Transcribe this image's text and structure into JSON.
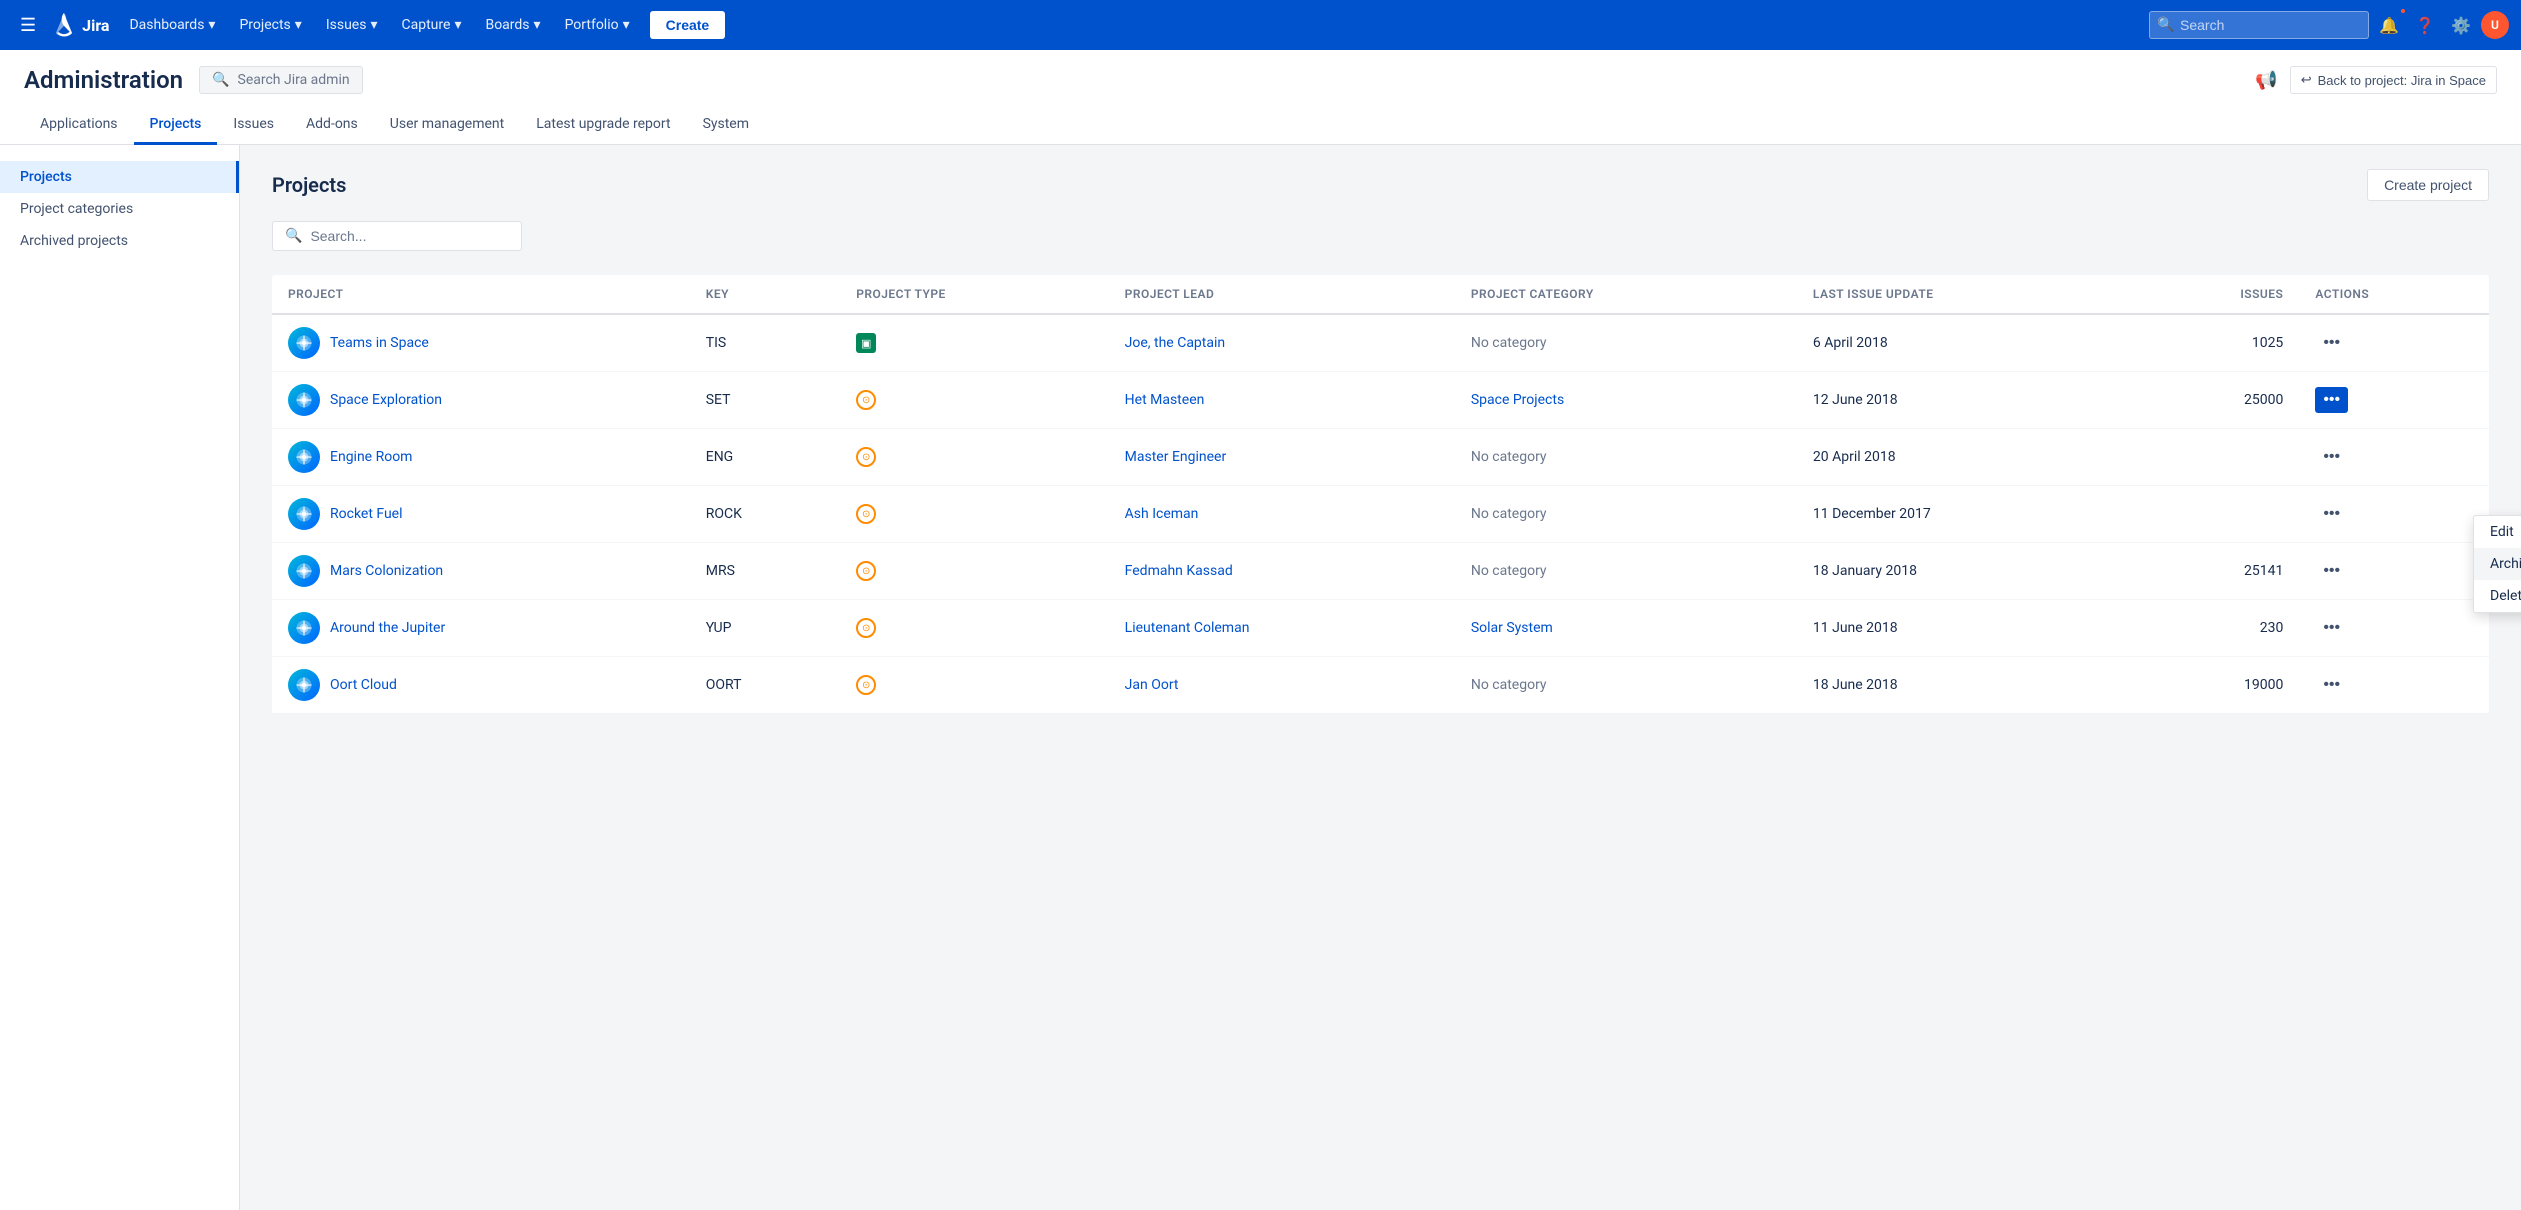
{
  "topnav": {
    "logo_text": "Jira",
    "menu_items": [
      {
        "label": "Dashboards",
        "has_dropdown": true
      },
      {
        "label": "Projects",
        "has_dropdown": true
      },
      {
        "label": "Issues",
        "has_dropdown": true
      },
      {
        "label": "Capture",
        "has_dropdown": true
      },
      {
        "label": "Boards",
        "has_dropdown": true
      },
      {
        "label": "Portfolio",
        "has_dropdown": true
      }
    ],
    "create_label": "Create",
    "search_placeholder": "Search",
    "back_to_project": "Back to project: Jira in Space"
  },
  "admin": {
    "title": "Administration",
    "search_placeholder": "Search Jira admin",
    "tabs": [
      {
        "label": "Applications"
      },
      {
        "label": "Projects",
        "active": true
      },
      {
        "label": "Issues"
      },
      {
        "label": "Add-ons"
      },
      {
        "label": "User management"
      },
      {
        "label": "Latest upgrade report"
      },
      {
        "label": "System"
      }
    ],
    "sidebar": [
      {
        "label": "Projects",
        "active": true
      },
      {
        "label": "Project categories"
      },
      {
        "label": "Archived projects"
      }
    ]
  },
  "projects_page": {
    "title": "Projects",
    "create_project_label": "Create project",
    "search_placeholder": "Search...",
    "columns": [
      {
        "label": "Project"
      },
      {
        "label": "Key"
      },
      {
        "label": "Project type"
      },
      {
        "label": "Project lead"
      },
      {
        "label": "Project category"
      },
      {
        "label": "Last issue update"
      },
      {
        "label": "Issues"
      },
      {
        "label": "Actions"
      }
    ],
    "projects": [
      {
        "name": "Teams in Space",
        "key": "TIS",
        "type": "software",
        "type_style": "green",
        "lead": "Joe, the Captain",
        "category": "No category",
        "category_is_link": false,
        "last_update": "6 April 2018",
        "issues": "1025",
        "icon_color": "teal"
      },
      {
        "name": "Space Exploration",
        "key": "SET",
        "type": "software",
        "type_style": "orange",
        "lead": "Het Masteen",
        "category": "Space Projects",
        "category_is_link": true,
        "last_update": "12 June 2018",
        "issues": "25000",
        "icon_color": "teal",
        "actions_active": true
      },
      {
        "name": "Engine Room",
        "key": "ENG",
        "type": "software",
        "type_style": "orange",
        "lead": "Master Engineer",
        "category": "No category",
        "category_is_link": false,
        "last_update": "20 April 2018",
        "issues": "",
        "icon_color": "teal"
      },
      {
        "name": "Rocket Fuel",
        "key": "ROCK",
        "type": "software",
        "type_style": "orange",
        "lead": "Ash Iceman",
        "category": "No category",
        "category_is_link": false,
        "last_update": "11 December 2017",
        "issues": "",
        "icon_color": "teal"
      },
      {
        "name": "Mars Colonization",
        "key": "MRS",
        "type": "software",
        "type_style": "orange",
        "lead": "Fedmahn Kassad",
        "category": "No category",
        "category_is_link": false,
        "last_update": "18 January 2018",
        "issues": "25141",
        "icon_color": "teal"
      },
      {
        "name": "Around the Jupiter",
        "key": "YUP",
        "type": "software",
        "type_style": "orange",
        "lead": "Lieutenant Coleman",
        "category": "Solar System",
        "category_is_link": true,
        "last_update": "11 June 2018",
        "issues": "230",
        "icon_color": "teal"
      },
      {
        "name": "Oort Cloud",
        "key": "OORT",
        "type": "software",
        "type_style": "orange",
        "lead": "Jan Oort",
        "category": "No category",
        "category_is_link": false,
        "last_update": "18 June 2018",
        "issues": "19000",
        "icon_color": "teal"
      }
    ],
    "dropdown_menu": {
      "items": [
        {
          "label": "Edit"
        },
        {
          "label": "Archive",
          "highlighted": true
        },
        {
          "label": "Delete"
        }
      ]
    }
  }
}
